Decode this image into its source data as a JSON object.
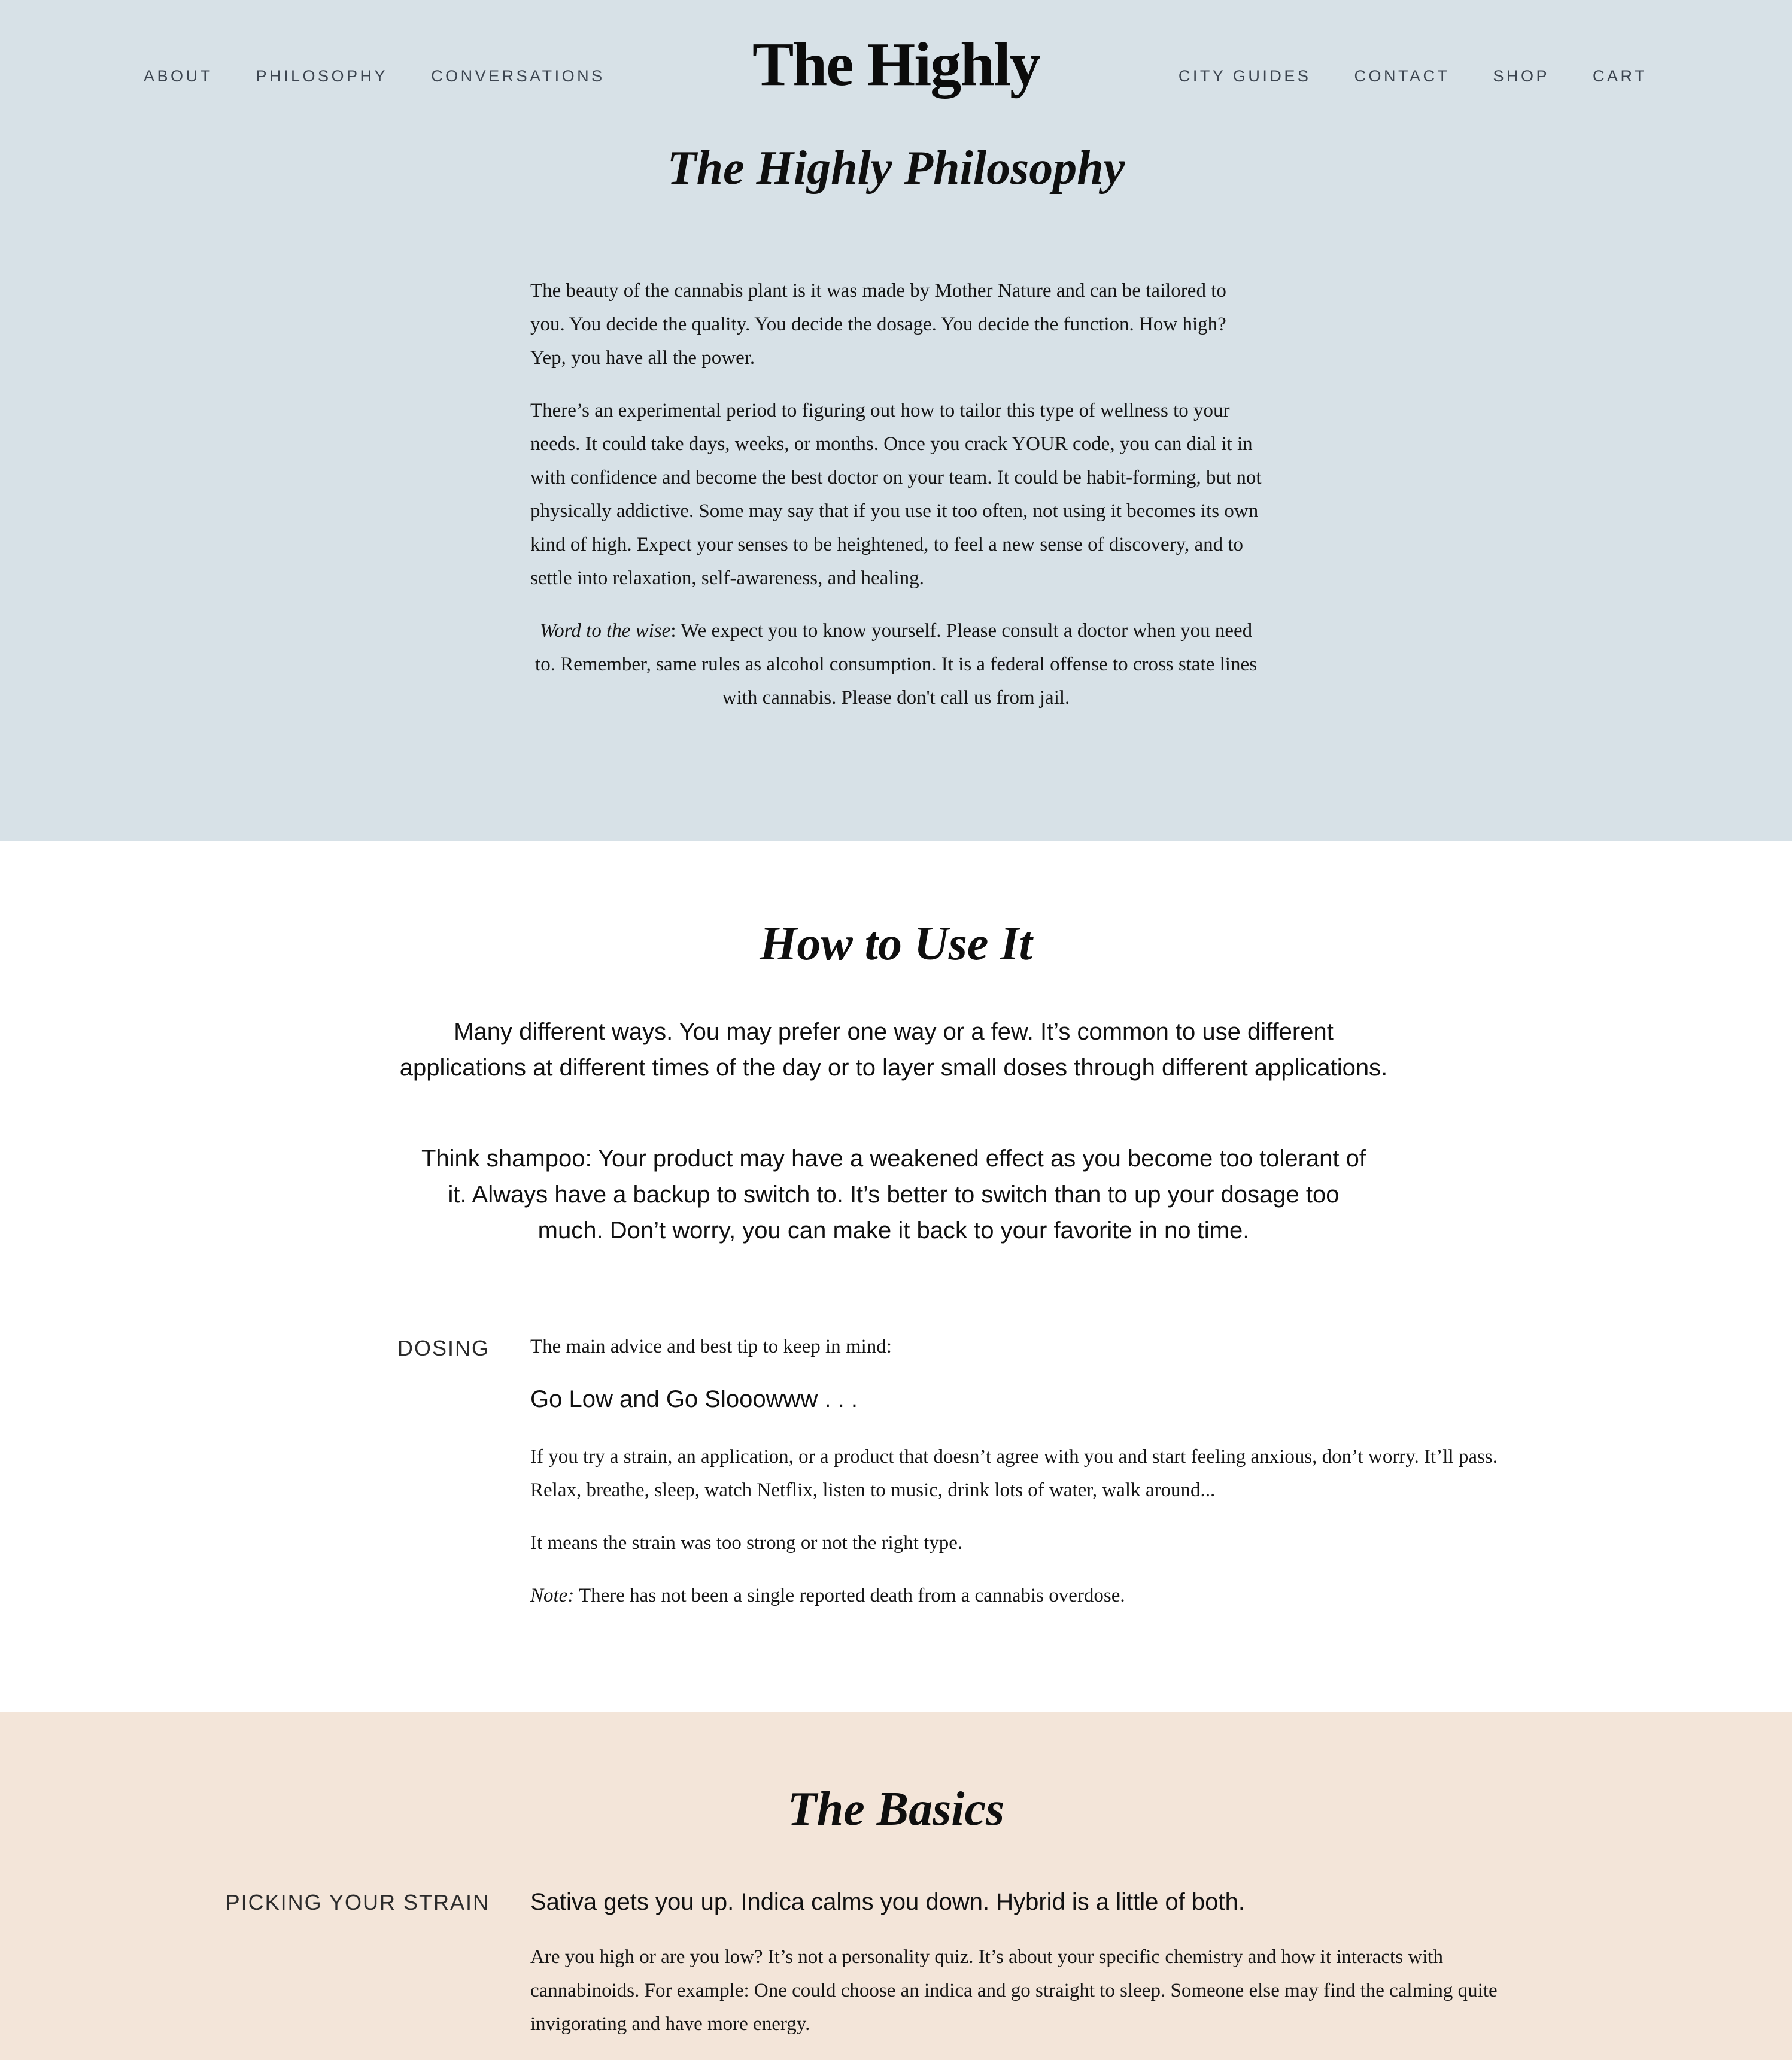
{
  "colors": {
    "hero_bg": "#d7e1e7",
    "howto_bg": "#ffffff",
    "basics_bg": "#f3e5d9",
    "text": "#111111",
    "nav_text": "#3c4550"
  },
  "nav": {
    "left": [
      "ABOUT",
      "PHILOSOPHY",
      "CONVERSATIONS"
    ],
    "logo": "The Highly",
    "right": [
      "CITY GUIDES",
      "CONTACT",
      "SHOP",
      "CART"
    ]
  },
  "philosophy": {
    "title": "The Highly Philosophy",
    "p1": "The beauty of the cannabis plant is it was made by Mother Nature and can be tailored to you. You decide the quality. You decide the dosage. You decide the function. How high? Yep, you have all the power.",
    "p2": "There’s an experimental period to figuring out how to tailor this type of wellness to your needs. It could take days, weeks, or months. Once you crack YOUR code, you can dial it in with confidence and become the best doctor on your team. It could be habit-forming, but not physically addictive. Some may say that if you use it too often, not using it becomes its own kind of high. Expect your senses to be heightened, to feel a new sense of discovery, and to settle into relaxation, self-awareness, and healing.",
    "p3_emph": "Word to the wise",
    "p3_rest": ": We expect you to know yourself. Please consult a doctor when you need to. Remember, same rules as alcohol consumption. It is a federal offense to cross state lines with cannabis. Please don't call us from jail."
  },
  "how_to_use": {
    "title": "How to Use It",
    "lead1": "Many different ways. You may prefer one way or a few. It’s common to use different applications at different times of the day or to layer small doses through different applications.",
    "lead2": "Think shampoo: Your product may have a weakened effect as you become too tolerant of it. Always have a backup to switch to. It’s better to switch than to up your dosage too much. Don’t worry, you can make it back to your favorite in no time.",
    "dosing": {
      "label": "DOSING",
      "intro": "The main advice and best tip to keep in mind:",
      "headline": "Go Low and Go Slooowww . . .",
      "p1": "If you try a strain, an application, or a product that doesn’t agree with you and start feeling anxious, don’t worry. It’ll pass. Relax, breathe, sleep, watch Netflix, listen to music, drink lots of water, walk around...",
      "p2": "It means the strain was too strong or not the right type.",
      "note_label": "Note:",
      "note_text": " There has not been a single reported death from a cannabis overdose."
    }
  },
  "basics": {
    "title": "The Basics",
    "strain": {
      "label": "PICKING YOUR STRAIN",
      "headline": "Sativa gets you up. Indica calms you down. Hybrid is a little of both.",
      "p1": "Are you high or are you low? It’s not a personality quiz. It’s about your specific chemistry and how it interacts with cannabinoids. For example: One could choose an indica and go straight to sleep. Someone else may find the calming quite invigorating and have more energy."
    }
  }
}
